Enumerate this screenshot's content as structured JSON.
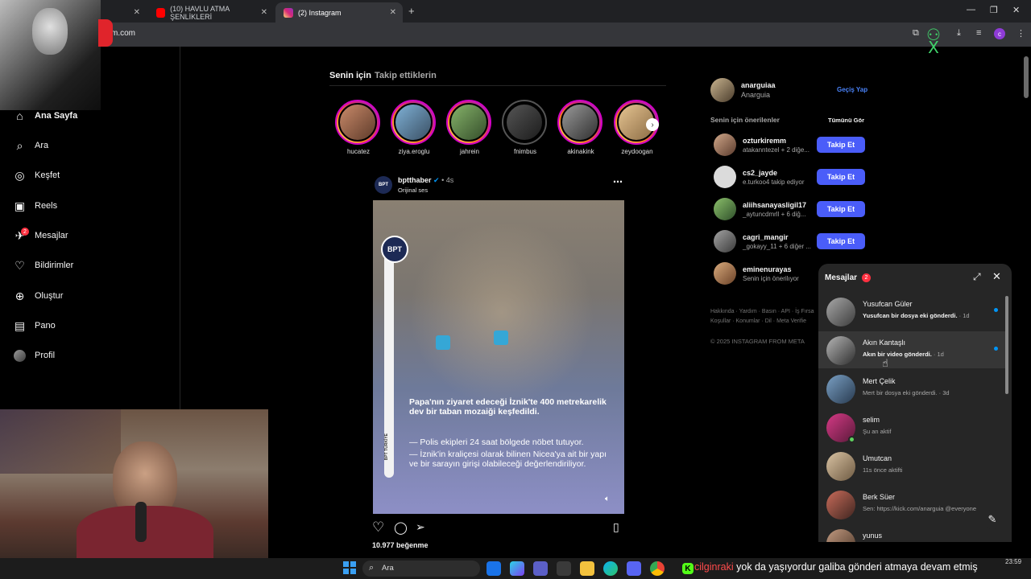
{
  "browser": {
    "tabs": [
      {
        "label": ""
      },
      {
        "label": "(10) HAVLU ATMA ŞENLİKLERİ"
      },
      {
        "label": "(2) Instagram"
      }
    ],
    "url": "m.com",
    "profile_initial": "c"
  },
  "sidebar": {
    "items": [
      {
        "label": "Ana Sayfa",
        "icon": "home-icon"
      },
      {
        "label": "Ara",
        "icon": "search-icon"
      },
      {
        "label": "Keşfet",
        "icon": "compass-icon"
      },
      {
        "label": "Reels",
        "icon": "reels-icon"
      },
      {
        "label": "Mesajlar",
        "icon": "messenger-icon",
        "badge": "2"
      },
      {
        "label": "Bildirimler",
        "icon": "heart-icon"
      },
      {
        "label": "Oluştur",
        "icon": "plus-square-icon"
      },
      {
        "label": "Pano",
        "icon": "dashboard-icon"
      },
      {
        "label": "Profil",
        "icon": "avatar"
      }
    ]
  },
  "feed": {
    "tabs": [
      "Senin için",
      "Takip ettiklerin"
    ],
    "stories": [
      "hucatez",
      "ziya.eroglu",
      "jahrein",
      "fnimbus",
      "akinakink",
      "zeydoogan"
    ],
    "post": {
      "username": "bptthaber",
      "time": "4s",
      "subtitle": "Orijinal ses",
      "logo_text": "BPT",
      "vertical_text": "BPT TÜRKİYE",
      "overlay_title": "Papa'nın ziyaret edeceği İznik'te 400 metrekarelik dev bir taban mozaiği keşfedildi.",
      "overlay_line1": "— Polis ekipleri 24 saat bölgede nöbet tutuyor.",
      "overlay_line2": "— İznik'in kraliçesi olarak bilinen Nicea'ya ait bir yapı ve bir sarayın girişi olabileceği değerlendiriliyor.",
      "likes": "10.977 beğenme"
    }
  },
  "right": {
    "me": {
      "username": "anarguiaa",
      "name": "Anarguia",
      "switch_label": "Geçiş Yap"
    },
    "suggest_title": "Senin için önerilenler",
    "see_all": "Tümünü Gör",
    "suggestions": [
      {
        "username": "ozturkiremm",
        "sub": "atakanntezel + 2 diğe...",
        "button": "Takip Et"
      },
      {
        "username": "cs2_jayde",
        "sub": "e.turkoo4 takip ediyor",
        "button": "Takip Et"
      },
      {
        "username": "aliihsanayasligil17",
        "sub": "_aytuncdmrll + 6 diğ...",
        "button": "Takip Et"
      },
      {
        "username": "cagri_mangir",
        "sub": "_gokayy_11 + 6 diğer ...",
        "button": "Takip Et"
      },
      {
        "username": "eminenurayas",
        "sub": "Senin için önerilıyor",
        "button": ""
      }
    ],
    "footer_line1": "Hakkında · Yardım · Basın · API · İş Fırsa",
    "footer_line2": "Koşullar · Konumlar · Dil · Meta Verifie",
    "copyright": "© 2025 INSTAGRAM FROM META"
  },
  "messages": {
    "title": "Mesajlar",
    "badge": "2",
    "conversations": [
      {
        "name": "Yusufcan Güler",
        "preview": "Yusufcan bir dosya eki gönderdi.",
        "time": " · 1d"
      },
      {
        "name": "Akın Kantaşlı",
        "preview": "Akın bir video gönderdi.",
        "time": " · 1d"
      },
      {
        "name": "Mert Çelik",
        "preview": "Mert bir dosya eki gönderdi.",
        "time": " · 3d"
      },
      {
        "name": "selim",
        "preview": "Şu an aktif",
        "time": ""
      },
      {
        "name": "Umutcan",
        "preview": "11s önce aktifti",
        "time": ""
      },
      {
        "name": "Berk Süer",
        "preview": "Sen: https://kick.com/anarguia @everyone",
        "time": ""
      },
      {
        "name": "yunus",
        "preview": "",
        "time": ""
      }
    ]
  },
  "taskbar": {
    "search_label": "Ara",
    "clock": "23:59",
    "ticker_user": "cilginraki",
    "ticker_text": "yok da yaşıyordur galiba gönderi atmaya devam etmiş"
  },
  "colors": {
    "accent": "#4a5df9",
    "unread_dot": "#0095f6",
    "badge": "#ff3040",
    "active_green": "#5fd35f"
  }
}
